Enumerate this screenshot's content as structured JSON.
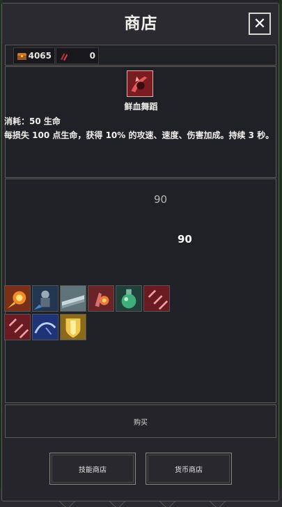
{
  "window": {
    "title": "商店",
    "close_label": "✕"
  },
  "currency": [
    {
      "icon": "treasure-chest-icon",
      "value": "4065"
    },
    {
      "icon": "red-claw-token-icon",
      "value": "0"
    }
  ],
  "selected_skill": {
    "icon": "blood-dance-icon",
    "name": "鲜血舞蹈",
    "cost": "消耗：50 生命",
    "description": "每损失 100 点生命，获得 10% 的攻速、速度、伤害加成。持续 3 秒。"
  },
  "floating_numbers": [
    "90",
    "90"
  ],
  "items": [
    {
      "icon": "fire-meteor-icon",
      "color": "#b8572a"
    },
    {
      "icon": "knight-charge-icon",
      "color": "#3b5b8a"
    },
    {
      "icon": "steel-blade-icon",
      "color": "#8fa3a8"
    },
    {
      "icon": "flame-palm-icon",
      "color": "#b0505a"
    },
    {
      "icon": "green-potion-icon",
      "color": "#3d8a6a"
    },
    {
      "icon": "blood-slashes-icon",
      "color": "#a33240"
    },
    {
      "icon": "blood-slashes-icon",
      "color": "#a33240"
    },
    {
      "icon": "chain-whip-icon",
      "color": "#2f4fa8"
    },
    {
      "icon": "golden-shield-icon",
      "color": "#d8b040"
    }
  ],
  "buttons": {
    "buy": "购买",
    "skill_shop": "技能商店",
    "currency_shop": "货币商店"
  }
}
